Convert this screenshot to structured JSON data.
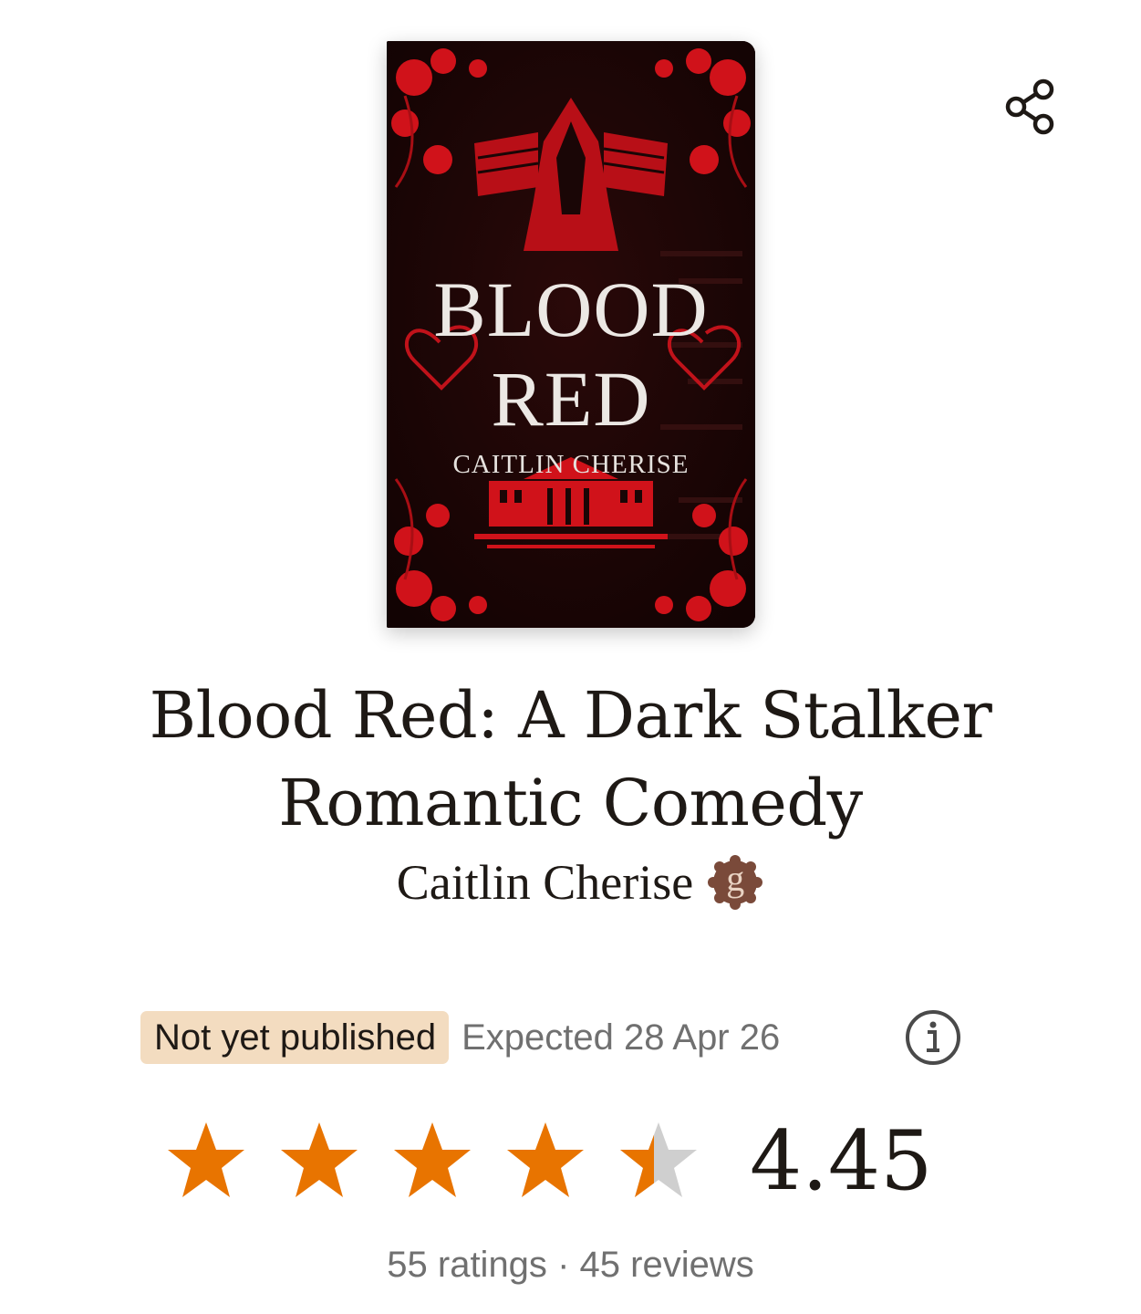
{
  "cover": {
    "title_line1": "BLOOD",
    "title_line2": "RED",
    "author": "CAITLIN CHERISE"
  },
  "book": {
    "title": "Blood Red: A Dark Stalker Romantic Comedy",
    "author": "Caitlin Cherise",
    "author_badge": "g"
  },
  "publication": {
    "status_label": "Not yet published",
    "expected_text": "Expected 28 Apr 26"
  },
  "rating": {
    "average": "4.45",
    "stars_filled": 4.45,
    "ratings_count": "55 ratings",
    "separator": "·",
    "reviews_count": "45 reviews"
  },
  "icons": {
    "share": "share-icon",
    "info": "info-icon",
    "star": "star-icon",
    "author_badge": "goodreads-author-badge-icon"
  },
  "colors": {
    "star_fill": "#e87400",
    "star_empty": "#cfcfcf",
    "badge_bg": "#f3dcc0",
    "author_badge": "#7a4a3a",
    "cover_red": "#d0121a",
    "cover_bg": "#1a0606"
  }
}
